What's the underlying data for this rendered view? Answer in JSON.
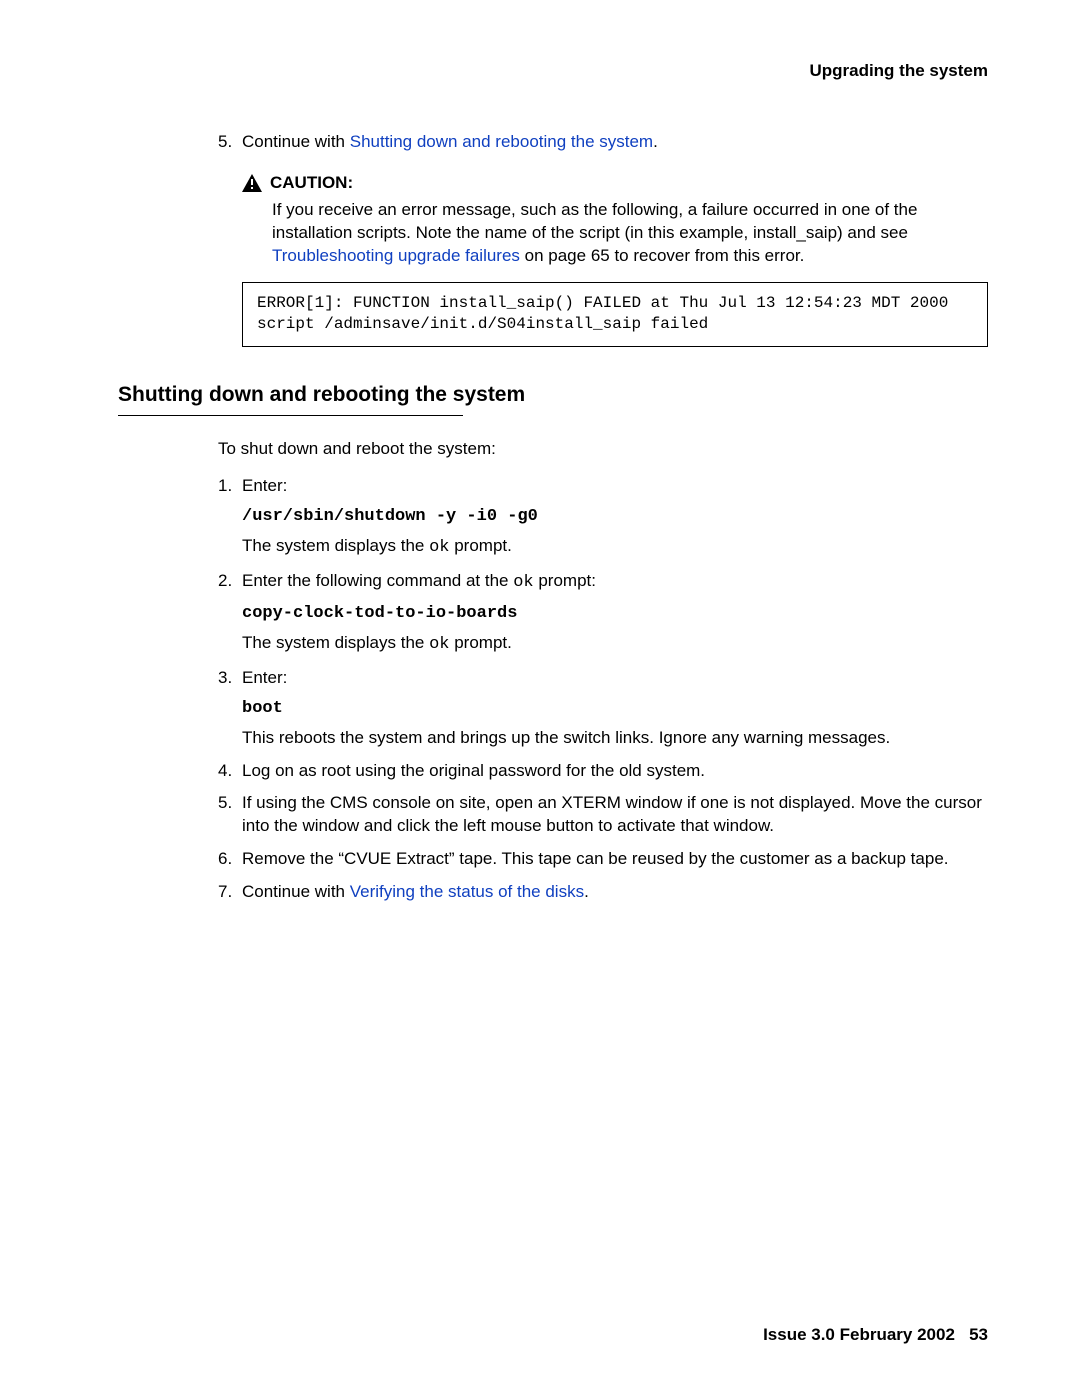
{
  "header": {
    "running": "Upgrading the system"
  },
  "top_item": {
    "number": "5.",
    "prefix": "Continue with ",
    "link": "Shutting down and rebooting the system",
    "suffix": "."
  },
  "caution": {
    "label": "CAUTION:",
    "body_before": "If you receive an error message, such as the following, a failure occurred in one of the installation scripts. Note the name of the script (in this example, install_saip) and see ",
    "link": "Troubleshooting upgrade failures",
    "body_after": " on page 65 to recover from this error."
  },
  "error_box": "ERROR[1]: FUNCTION install_saip() FAILED at Thu Jul 13 12:54:23 MDT 2000\nscript /adminsave/init.d/S04install_saip failed",
  "section": {
    "title": "Shutting down and rebooting the system",
    "intro": "To shut down and reboot the system:"
  },
  "steps": {
    "s1": {
      "num": "1.",
      "text": "Enter:",
      "cmd": "/usr/sbin/shutdown -y -i0 -g0",
      "note_before": "The system displays the ",
      "note_code": "ok",
      "note_after": " prompt."
    },
    "s2": {
      "num": "2.",
      "text_before": "Enter the following command at the ",
      "text_code": "ok",
      "text_after": " prompt:",
      "cmd": "copy-clock-tod-to-io-boards",
      "note_before": "The system displays the ",
      "note_code": "ok",
      "note_after": " prompt."
    },
    "s3": {
      "num": "3.",
      "text": "Enter:",
      "cmd": "boot",
      "note": "This reboots the system and brings up the switch links. Ignore any warning messages."
    },
    "s4": {
      "num": "4.",
      "text": "Log on as root using the original password for the old system."
    },
    "s5": {
      "num": "5.",
      "text": "If using the CMS console on site, open an XTERM window if one is not displayed. Move the cursor into the window and click the left mouse button to activate that window."
    },
    "s6": {
      "num": "6.",
      "text": "Remove the “CVUE Extract” tape. This tape can be reused by the customer as a backup tape."
    },
    "s7": {
      "num": "7.",
      "text_before": "Continue with ",
      "link": "Verifying the status of the disks",
      "text_after": "."
    }
  },
  "footer": {
    "issue": "Issue 3.0   February 2002",
    "page": "53"
  }
}
